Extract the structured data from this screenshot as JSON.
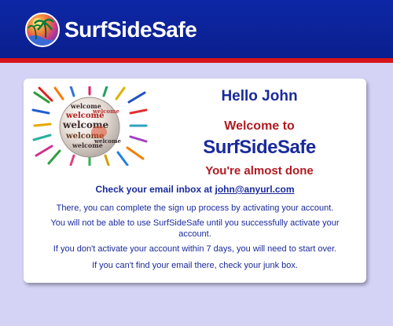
{
  "header": {
    "brand": "SurfSideSafe",
    "colors": {
      "bar": "#0d27a6",
      "stripe": "#d8141b"
    }
  },
  "banner": {
    "words": [
      "welcome",
      "welcome",
      "welcome",
      "welcome",
      "welcome",
      "welcome",
      "welcome"
    ]
  },
  "card": {
    "greeting": "Hello John",
    "welcome_to": "Welcome to",
    "brand": "SurfSideSafe",
    "almost_done": "You're almost done",
    "check_email_prefix": "Check your email inbox at",
    "email": "john@anyurl.com",
    "paragraphs": [
      "There, you can complete the sign up process by activating your account.",
      "You will not be able to use SurfSideSafe until you successfully activate your account.",
      "If you don't activate your account within 7 days, you will need to start over.",
      "If you can't find your email there, check your junk box."
    ]
  }
}
